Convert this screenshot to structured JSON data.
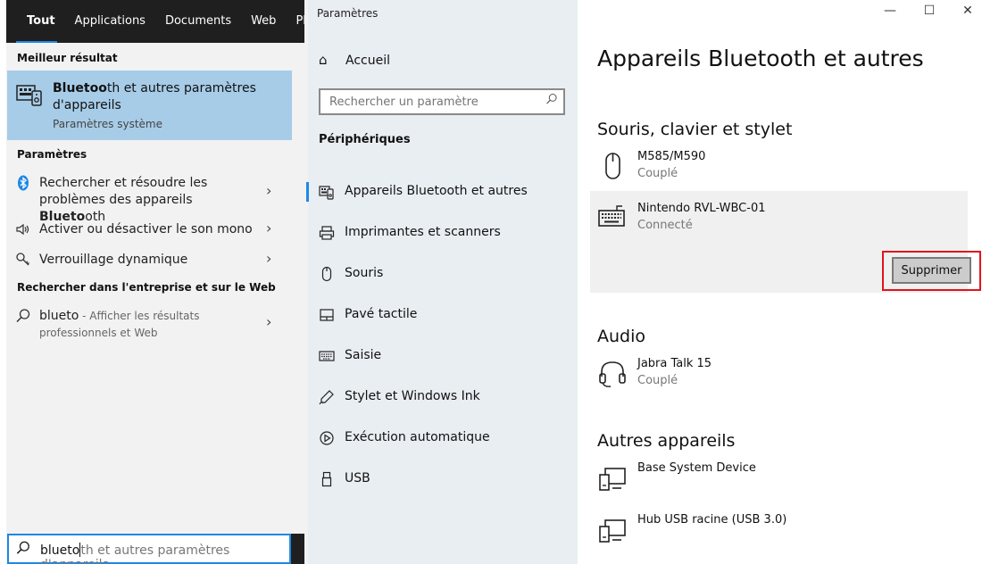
{
  "search": {
    "tabs": [
      "Tout",
      "Applications",
      "Documents",
      "Web",
      "Plus"
    ],
    "best_result_heading": "Meilleur résultat",
    "best_result": {
      "title_bold": "Bluetoo",
      "title_rest": "th et autres paramètres d'appareils",
      "subtitle": "Paramètres système"
    },
    "settings_heading": "Paramètres",
    "settings_items": [
      {
        "pre": "Rechercher et résoudre les problèmes des appareils ",
        "bold": "Blueto",
        "post": "oth",
        "icon": "bluetooth-icon"
      },
      {
        "pre": "Activer ou désactiver le son mono",
        "bold": "",
        "post": "",
        "icon": "speaker-icon"
      },
      {
        "pre": "Verrouillage dynamique",
        "bold": "",
        "post": "",
        "icon": "key-icon"
      }
    ],
    "web_heading": "Rechercher dans l'entreprise et sur le Web",
    "web_item": {
      "query": "blueto",
      "hint": " - Afficher les résultats professionnels et Web"
    },
    "box": {
      "typed": "blueto",
      "suffix": "th et autres paramètres d'appareils"
    }
  },
  "settings_nav": {
    "window_title": "Paramètres",
    "home": "Accueil",
    "search_placeholder": "Rechercher un paramètre",
    "section": "Périphériques",
    "items": [
      {
        "label": "Appareils Bluetooth et autres",
        "icon": "bluetooth-devices-icon",
        "selected": true
      },
      {
        "label": "Imprimantes et scanners",
        "icon": "printer-icon"
      },
      {
        "label": "Souris",
        "icon": "mouse-icon"
      },
      {
        "label": "Pavé tactile",
        "icon": "touchpad-icon"
      },
      {
        "label": "Saisie",
        "icon": "keyboard-icon"
      },
      {
        "label": "Stylet et Windows Ink",
        "icon": "pen-icon"
      },
      {
        "label": "Exécution automatique",
        "icon": "autoplay-icon"
      },
      {
        "label": "USB",
        "icon": "usb-icon"
      }
    ]
  },
  "main": {
    "title": "Appareils Bluetooth et autres",
    "groups": [
      {
        "title": "Souris, clavier et stylet",
        "devices": [
          {
            "name": "M585/M590",
            "status": "Couplé",
            "icon": "mouse-icon"
          },
          {
            "name": "Nintendo RVL-WBC-01",
            "status": "Connecté",
            "icon": "keyboard-icon",
            "selected": true
          }
        ]
      },
      {
        "title": "Audio",
        "devices": [
          {
            "name": "Jabra Talk 15",
            "status": "Couplé",
            "icon": "headset-icon"
          }
        ]
      },
      {
        "title": "Autres appareils",
        "devices": [
          {
            "name": "Base System Device",
            "status": "",
            "icon": "generic-device-icon"
          },
          {
            "name": "Hub USB racine (USB 3.0)",
            "status": "",
            "icon": "generic-device-icon"
          }
        ]
      }
    ],
    "remove_button": "Supprimer",
    "highlight_color": "#e0141d"
  },
  "window_controls": {
    "minimize": "—",
    "maximize": "☐",
    "close": "✕"
  },
  "colors": {
    "accent": "#1e88e5",
    "best_result_bg": "#a7cce8",
    "taskbar": "#1f1f1f"
  }
}
